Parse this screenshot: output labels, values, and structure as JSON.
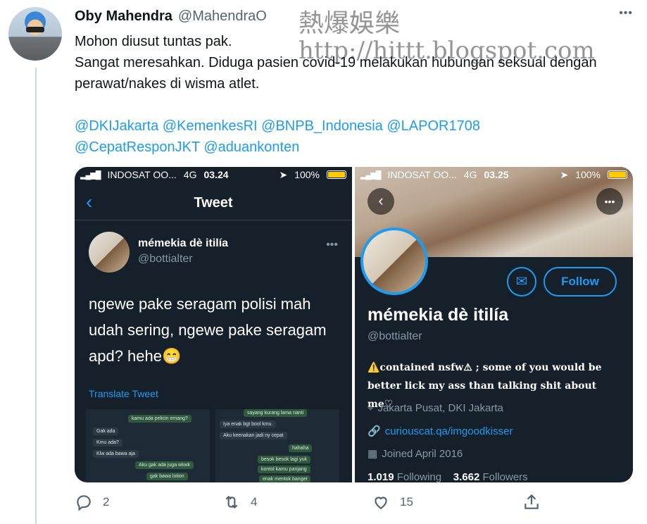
{
  "tweet": {
    "author_name": "Oby Mahendra",
    "author_handle": "@MahendraO",
    "more_label": "•••",
    "text_line1": "Mohon diusut tuntas pak.",
    "text_line2": "Sangat meresahkan. Diduga pasien covid-19 melakukan hubungan seksual dengan perawat/nakes di wisma atlet.",
    "mentions": [
      "@DKIJakarta",
      "@KemenkesRI",
      "@BNPB_Indonesia",
      "@LAPOR1708",
      "@CepatResponJKT",
      "@aduankonten"
    ]
  },
  "watermark": {
    "title": "熱爆娛樂",
    "url": "http://hittt.blogspot.com"
  },
  "screenshot_left": {
    "carrier": "INDOSAT OO...",
    "network": "4G",
    "time": "03.24",
    "battery": "100%",
    "nav_title": "Tweet",
    "name": "mémekia dè itilía",
    "handle": "@bottialter",
    "text": "ngewe pake seragam polisi mah udah sering, ngewe pake seragam apd? hehe😁",
    "translate": "Translate Tweet",
    "chat_left": [
      {
        "text": "kamu ada pelicin emang?",
        "dir": "out"
      },
      {
        "text": "Gak ada",
        "dir": "in"
      },
      {
        "text": "Kmu ada?",
        "dir": "in"
      },
      {
        "text": "Klw ada bawa aja",
        "dir": "in"
      },
      {
        "text": "Aku gak ada juga wkwk",
        "dir": "out"
      },
      {
        "text": "gak bawa lotion",
        "dir": "out"
      }
    ],
    "chat_right": [
      {
        "text": "sayang kurang lama nanti",
        "dir": "out"
      },
      {
        "text": "Iya enak bgt bool kmu.",
        "dir": "in"
      },
      {
        "text": "Aku keenakan jadi ny cepat",
        "dir": "in"
      },
      {
        "text": "hahaha",
        "dir": "out"
      },
      {
        "text": "besok besok lagi yuk",
        "dir": "out"
      },
      {
        "text": "kontol kamu panjang",
        "dir": "out"
      },
      {
        "text": "enak mentok banget",
        "dir": "out"
      }
    ]
  },
  "screenshot_right": {
    "carrier": "INDOSAT OO...",
    "network": "4G",
    "time": "03.25",
    "battery": "100%",
    "follow_label": "Follow",
    "name": "mémekia dè itilía",
    "handle": "@bottialter",
    "bio": "⚠️contained nsfw⚠ ; some of you would be better lick my ass than talking shit about me♡",
    "location": "Jakarta Pusat, DKI Jakarta",
    "link": "curiouscat.qa/imgoodkisser",
    "joined": "Joined April 2016",
    "following_count": "1.019",
    "following_label": "Following",
    "followers_count": "3.662",
    "followers_label": "Followers"
  },
  "actions": {
    "reply_count": "2",
    "retweet_count": "4",
    "like_count": "15"
  }
}
